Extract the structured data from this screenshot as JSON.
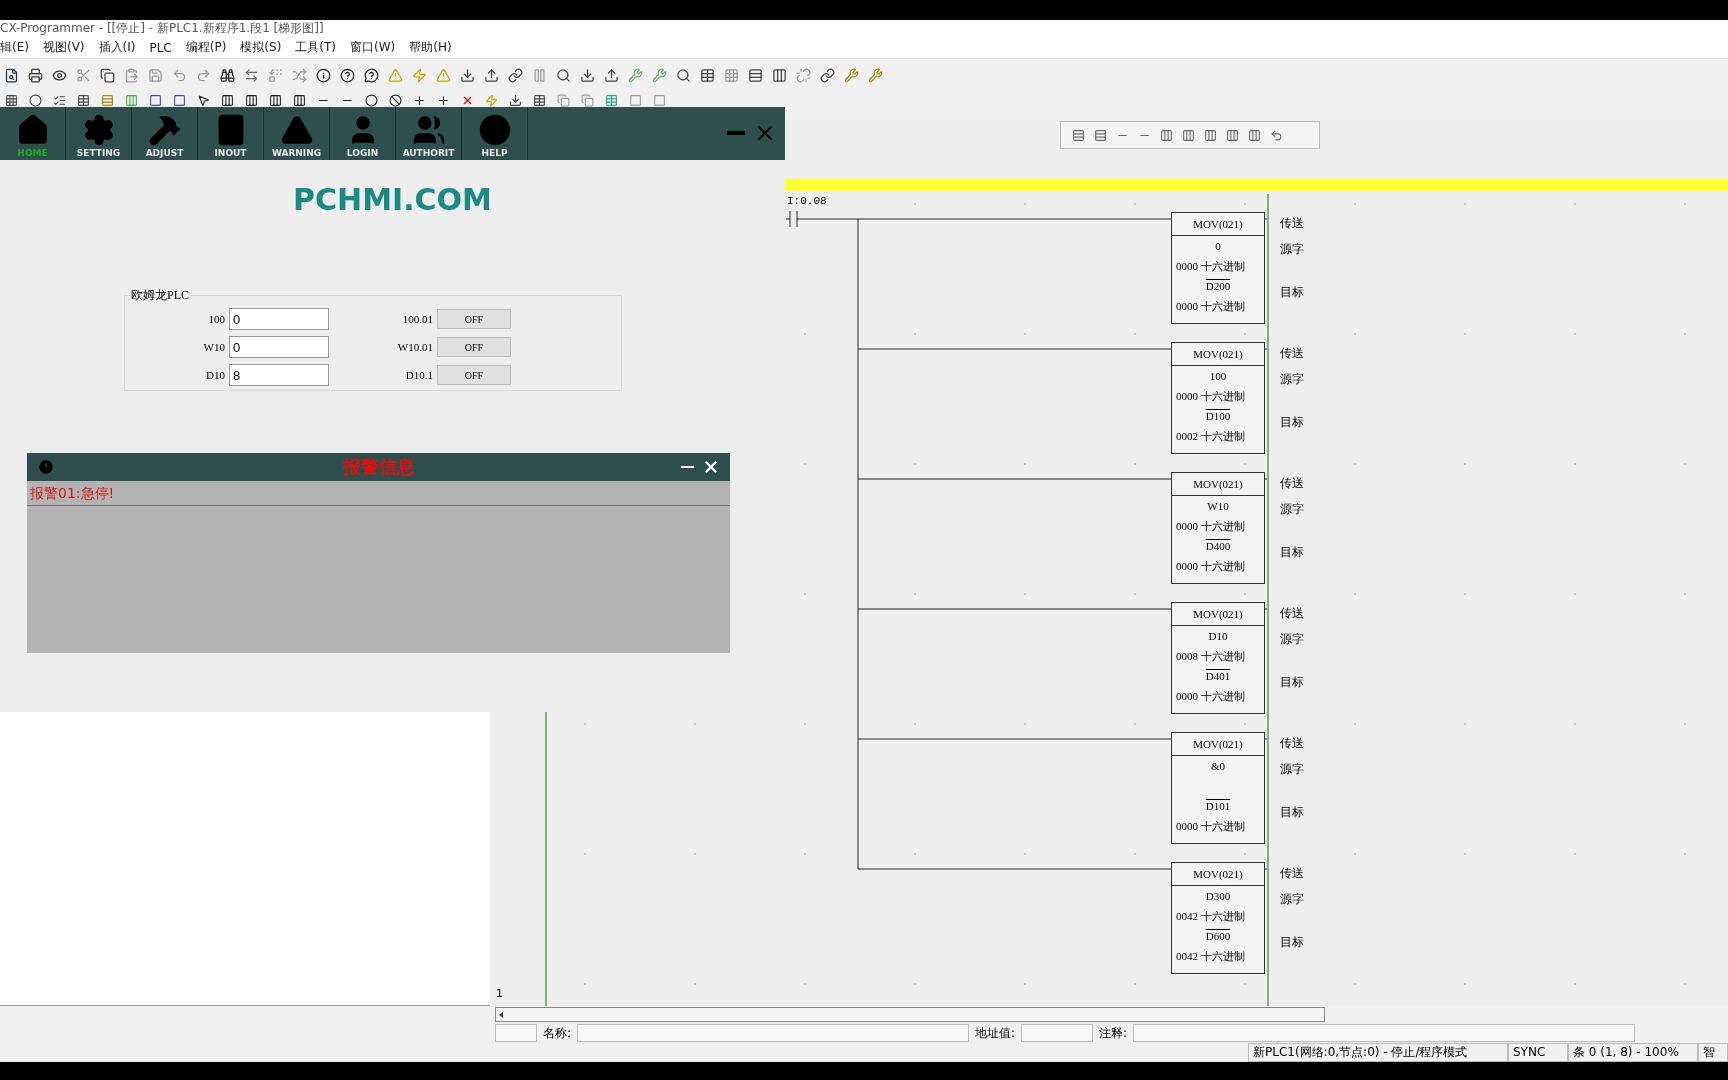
{
  "window": {
    "title": "CX-Programmer - [[停止] - 新PLC1.新程序1.段1 [梯形图]]"
  },
  "menu": [
    "辑(E)",
    "视图(V)",
    "插入(I)",
    "PLC",
    "编程(P)",
    "模拟(S)",
    "工具(T)",
    "窗口(W)",
    "帮助(H)"
  ],
  "hmi": {
    "nav": [
      {
        "label": "HOME",
        "selected": true
      },
      {
        "label": "SETTING",
        "selected": false
      },
      {
        "label": "ADJUST",
        "selected": false
      },
      {
        "label": "INOUT",
        "selected": false
      },
      {
        "label": "WARNING",
        "selected": false
      },
      {
        "label": "LOGIN",
        "selected": false
      },
      {
        "label": "AUTHORIT",
        "selected": false
      },
      {
        "label": "HELP",
        "selected": false
      }
    ],
    "brand": "PCHMI.COM",
    "group": {
      "title": "欧姆龙PLC",
      "words": [
        {
          "label": "100",
          "value": "0"
        },
        {
          "label": "W10",
          "value": "0"
        },
        {
          "label": "D10",
          "value": "8"
        }
      ],
      "bits": [
        {
          "label": "100.01",
          "state": "OFF"
        },
        {
          "label": "W10.01",
          "state": "OFF"
        },
        {
          "label": "D10.1",
          "state": "OFF"
        }
      ]
    },
    "alarm": {
      "title": "报警信息",
      "entries": [
        "报警01:急停!"
      ]
    }
  },
  "ladder": {
    "contact": "I:0.08",
    "rung_number": "1",
    "blocks": [
      {
        "instruction": "MOV(021)",
        "source": "0",
        "source_reading": "0000 十六进制",
        "dest": "D200",
        "dest_reading": "0000 十六进制",
        "comments": [
          "传送",
          "源字",
          "目标"
        ]
      },
      {
        "instruction": "MOV(021)",
        "source": "100",
        "source_reading": "0000 十六进制",
        "dest": "D100",
        "dest_reading": "0002 十六进制",
        "comments": [
          "传送",
          "源字",
          "目标"
        ]
      },
      {
        "instruction": "MOV(021)",
        "source": "W10",
        "source_reading": "0000 十六进制",
        "dest": "D400",
        "dest_reading": "0000 十六进制",
        "comments": [
          "传送",
          "源字",
          "目标"
        ]
      },
      {
        "instruction": "MOV(021)",
        "source": "D10",
        "source_reading": "0008 十六进制",
        "dest": "D401",
        "dest_reading": "0000 十六进制",
        "comments": [
          "传送",
          "源字",
          "目标"
        ]
      },
      {
        "instruction": "MOV(021)",
        "source": "&0",
        "dest": "D101",
        "dest_reading": "0000 十六进制",
        "comments": [
          "传送",
          "源字",
          "目标"
        ]
      },
      {
        "instruction": "MOV(021)",
        "source": "D300",
        "source_reading": "0042 十六进制",
        "dest": "D600",
        "dest_reading": "0042 十六进制",
        "comments": [
          "传送",
          "源字",
          "目标"
        ]
      }
    ]
  },
  "info_bar": {
    "name_label": "名称:",
    "address_label": "地址值:",
    "comment_label": "注释:"
  },
  "status_bar": [
    "新PLC1(网络:0,节点:0) - 停止/程序模式",
    "SYNC",
    "条 0 (1, 8) - 100%",
    "智"
  ]
}
